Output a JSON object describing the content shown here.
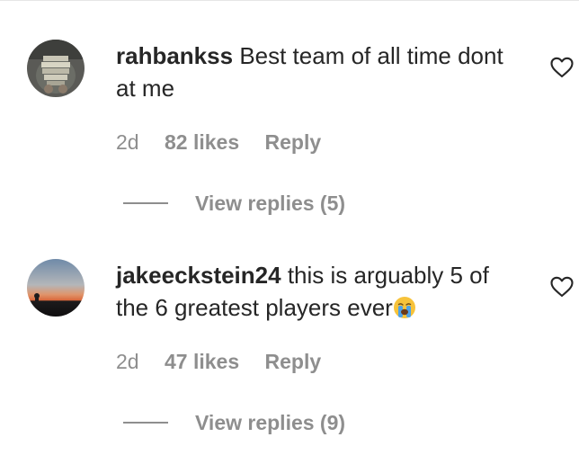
{
  "comments": [
    {
      "username": "rahbankss",
      "text": "Best team of all time dont at me",
      "emoji": "",
      "age": "2d",
      "likes": "82 likes",
      "reply_label": "Reply",
      "view_replies": "View replies (5)",
      "avatar_icon": "money-stack-photo"
    },
    {
      "username": "jakeeckstein24",
      "text": "this is arguably 5 of the 6 greatest players ever",
      "emoji": "loudly-crying-face-emoji",
      "age": "2d",
      "likes": "47 likes",
      "reply_label": "Reply",
      "view_replies": "View replies (9)",
      "avatar_icon": "sunset-photo"
    }
  ],
  "icons": {
    "like": "heart-outline-icon"
  },
  "colors": {
    "text": "#262626",
    "secondary": "#8e8e8e"
  }
}
